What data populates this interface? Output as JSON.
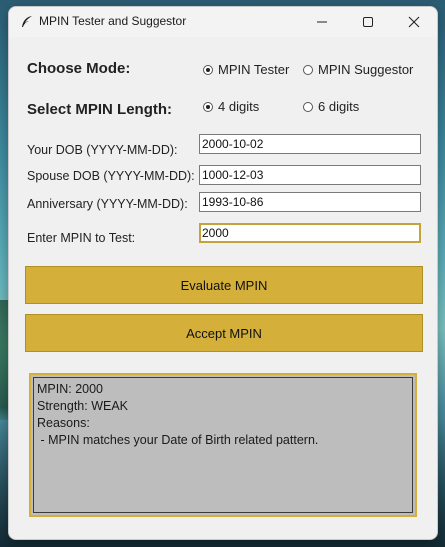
{
  "window": {
    "title": "MPIN Tester and Suggestor",
    "icon": "feather-icon",
    "controls": [
      "minimize-icon",
      "maximize-icon",
      "close-icon"
    ]
  },
  "mode": {
    "label": "Choose Mode:",
    "options": [
      {
        "label": "MPIN Tester",
        "selected": true
      },
      {
        "label": "MPIN Suggestor",
        "selected": false
      }
    ]
  },
  "length": {
    "label": "Select MPIN Length:",
    "options": [
      {
        "label": "4 digits",
        "selected": true
      },
      {
        "label": "6 digits",
        "selected": false
      }
    ]
  },
  "fields": {
    "dob": {
      "label": "Your DOB (YYYY-MM-DD):",
      "value": "2000-10-02"
    },
    "spouse_dob": {
      "label": "Spouse DOB (YYYY-MM-DD):",
      "value": "1000-12-03"
    },
    "anniversary": {
      "label": "Anniversary (YYYY-MM-DD):",
      "value": "1993-10-86"
    },
    "mpin": {
      "label": "Enter MPIN to Test:",
      "value": "2000"
    }
  },
  "buttons": {
    "evaluate": "Evaluate MPIN",
    "accept": "Accept MPIN"
  },
  "result": {
    "lines": [
      "MPIN: 2000",
      "Strength: WEAK",
      "Reasons:",
      " - MPIN matches your Date of Birth related pattern."
    ]
  },
  "colors": {
    "accent": "#d4b03a",
    "result_bg": "#bdbdbd"
  }
}
